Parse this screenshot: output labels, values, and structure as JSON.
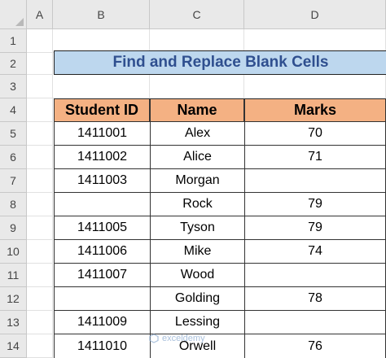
{
  "columns": [
    "A",
    "B",
    "C",
    "D"
  ],
  "rows": [
    "1",
    "2",
    "3",
    "4",
    "5",
    "6",
    "7",
    "8",
    "9",
    "10",
    "11",
    "12",
    "13",
    "14"
  ],
  "title": "Find and Replace Blank Cells",
  "table": {
    "headers": [
      "Student ID",
      "Name",
      "Marks"
    ],
    "rows": [
      {
        "id": "1411001",
        "name": "Alex",
        "marks": "70"
      },
      {
        "id": "1411002",
        "name": "Alice",
        "marks": "71"
      },
      {
        "id": "1411003",
        "name": "Morgan",
        "marks": ""
      },
      {
        "id": "",
        "name": "Rock",
        "marks": "79"
      },
      {
        "id": "1411005",
        "name": "Tyson",
        "marks": "79"
      },
      {
        "id": "1411006",
        "name": "Mike",
        "marks": "74"
      },
      {
        "id": "1411007",
        "name": "Wood",
        "marks": ""
      },
      {
        "id": "",
        "name": "Golding",
        "marks": "78"
      },
      {
        "id": "1411009",
        "name": "Lessing",
        "marks": ""
      },
      {
        "id": "1411010",
        "name": "Orwell",
        "marks": "76"
      }
    ]
  },
  "watermark": "exceldemy",
  "colors": {
    "header_fill": "#f4b183",
    "title_fill": "#bdd7ee",
    "title_text": "#2f4f8f"
  }
}
